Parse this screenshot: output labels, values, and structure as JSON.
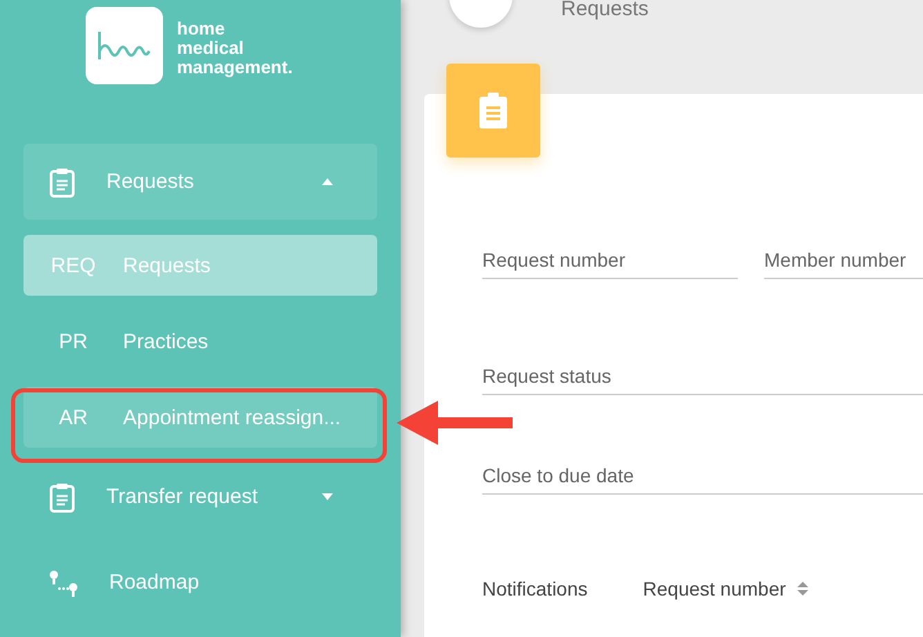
{
  "logo": {
    "text": "home medical management."
  },
  "header": {
    "title": "Requests"
  },
  "sidebar": {
    "items": [
      {
        "kind": "group",
        "label": "Requests",
        "expanded": true,
        "children": [
          {
            "abbr": "REQ",
            "label": "Requests",
            "selected": true,
            "hovered": false
          },
          {
            "abbr": "PR",
            "label": "Practices",
            "selected": false,
            "hovered": false
          },
          {
            "abbr": "AR",
            "label": "Appointment reassign...",
            "selected": false,
            "hovered": true
          }
        ]
      },
      {
        "kind": "group",
        "label": "Transfer request",
        "expanded": false
      },
      {
        "kind": "link",
        "label": "Roadmap"
      }
    ]
  },
  "filters": [
    [
      {
        "placeholder": "Request number"
      },
      {
        "placeholder": "Member number"
      }
    ],
    [
      {
        "placeholder": "Request status"
      }
    ],
    [
      {
        "placeholder": "Close to due date"
      }
    ]
  ],
  "table": {
    "columns": [
      {
        "label": "Notifications",
        "sortable": false
      },
      {
        "label": "Request number",
        "sortable": true
      }
    ]
  }
}
